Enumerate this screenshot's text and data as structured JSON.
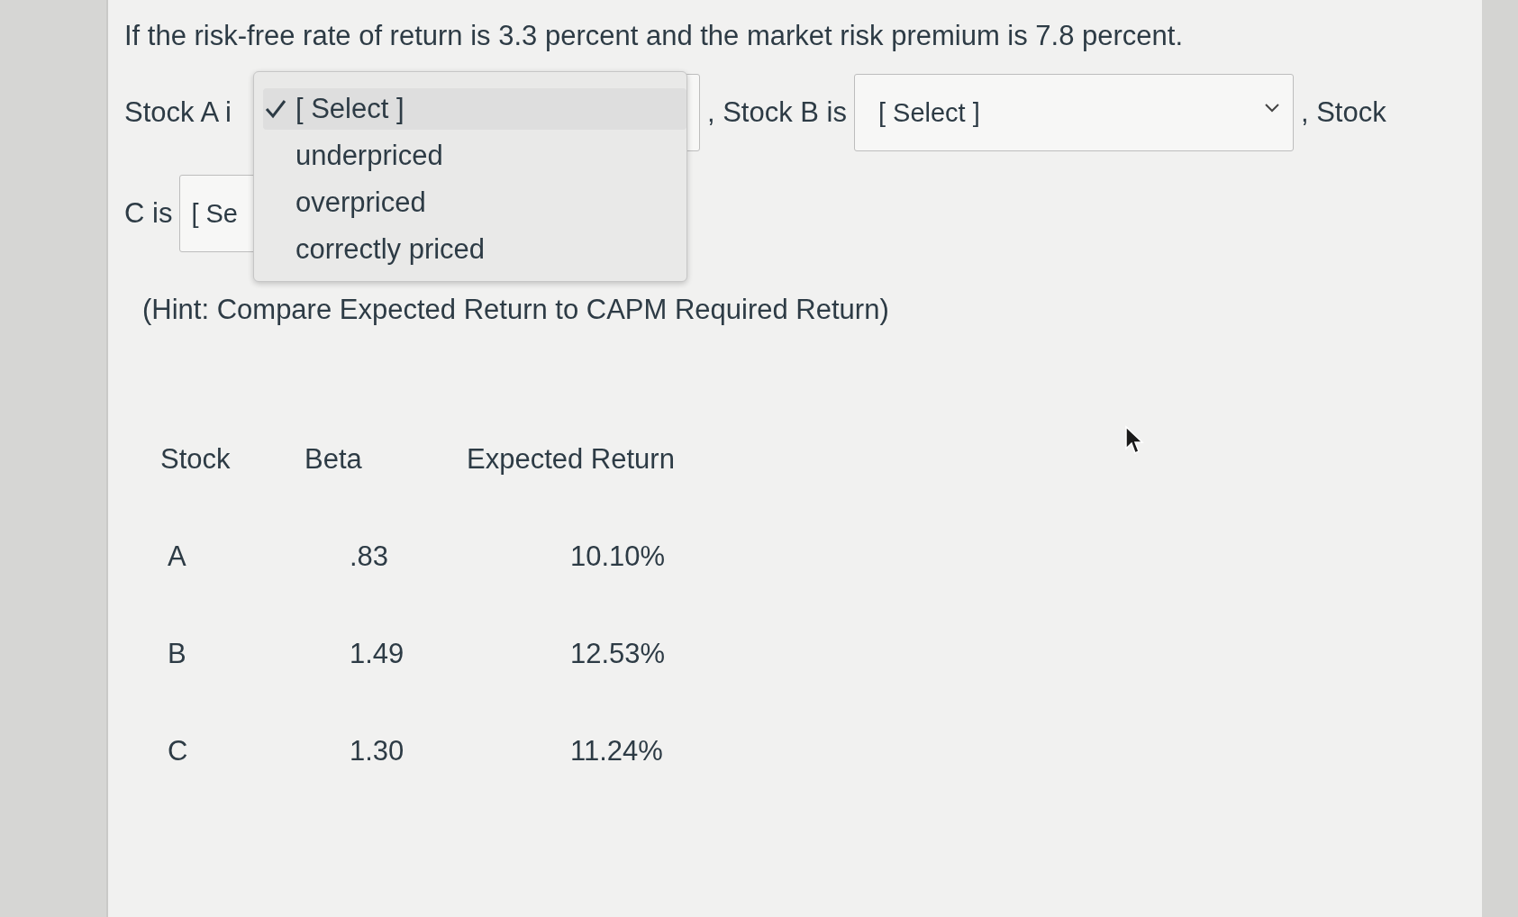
{
  "question": "If the risk-free rate of return is 3.3 percent and the market risk premium is 7.8 percent.",
  "lines": [
    [
      {
        "kind": "text",
        "text": "Stock A i"
      },
      {
        "kind": "dropdown",
        "expanded": true,
        "options": [
          {
            "text": "[ Select ]",
            "selected": true
          },
          {
            "text": "underpriced",
            "selected": false
          },
          {
            "text": "overpriced",
            "selected": false
          },
          {
            "text": "correctly priced",
            "selected": false
          }
        ]
      },
      {
        "kind": "text",
        "text": ", Stock B is"
      },
      {
        "kind": "dropdown",
        "expanded": false,
        "value": "[ Select ]"
      },
      {
        "kind": "text",
        "text": ", Stock"
      }
    ],
    [
      {
        "kind": "text",
        "text": "C is"
      },
      {
        "kind": "dropdown",
        "expanded": false,
        "value": "[ Se"
      }
    ]
  ],
  "hint": "(Hint: Compare Expected Return to CAPM Required Return)",
  "table": {
    "columns": [
      "Stock",
      "Beta",
      "Expected Return"
    ],
    "rows": [
      [
        "A",
        ".83",
        "10.10%"
      ],
      [
        "B",
        "1.49",
        "12.53%"
      ],
      [
        "C",
        "1.30",
        "11.24%"
      ]
    ]
  }
}
